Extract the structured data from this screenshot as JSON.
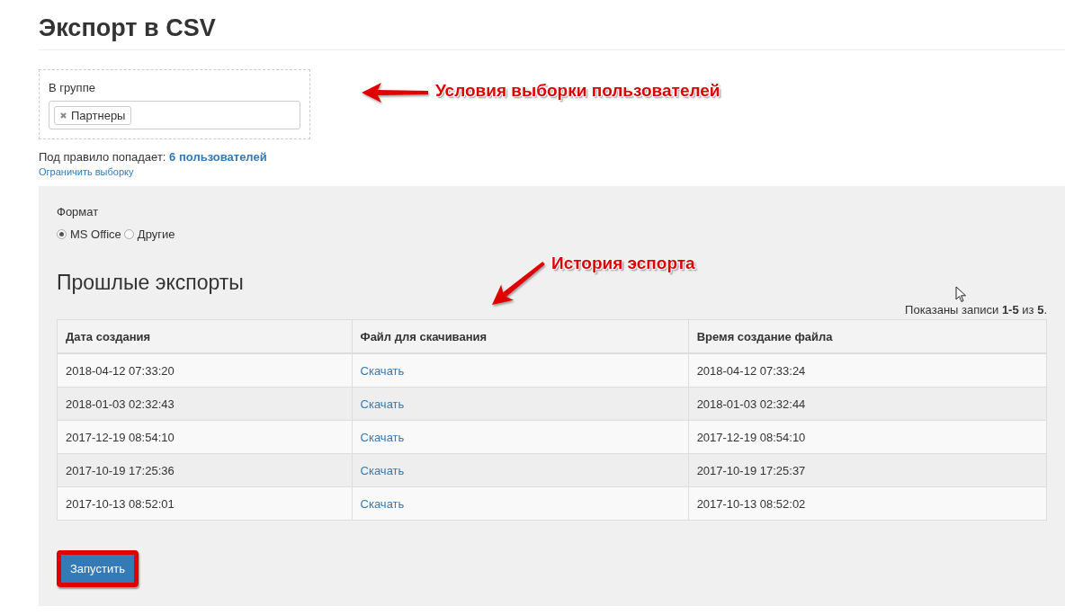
{
  "page_title": "Экспорт в CSV",
  "filter": {
    "label": "В группе",
    "tags": [
      {
        "label": "Партнеры"
      }
    ]
  },
  "match": {
    "text": "Под правило попадает:",
    "link": "6 пользователей",
    "limit_link": "Ограничить выборку"
  },
  "format": {
    "label": "Формат",
    "options": [
      {
        "label": "MS Office",
        "selected": true
      },
      {
        "label": "Другие",
        "selected": false
      }
    ]
  },
  "exports": {
    "title": "Прошлые экспорты",
    "summary": "Показаны записи **1-5** из **5**.",
    "columns": [
      "Дата создания",
      "Файл для скачивания",
      "Время создание файла"
    ],
    "rows": [
      {
        "created": "2018-04-12 07:33:20",
        "link": "Скачать",
        "finished": "2018-04-12 07:33:24"
      },
      {
        "created": "2018-01-03 02:32:43",
        "link": "Скачать",
        "finished": "2018-01-03 02:32:44"
      },
      {
        "created": "2017-12-19 08:54:10",
        "link": "Скачать",
        "finished": "2017-12-19 08:54:10"
      },
      {
        "created": "2017-10-19 17:25:36",
        "link": "Скачать",
        "finished": "2017-10-19 17:25:37"
      },
      {
        "created": "2017-10-13 08:52:01",
        "link": "Скачать",
        "finished": "2017-10-13 08:52:02"
      }
    ]
  },
  "run_button": "Запустить",
  "annotations": [
    {
      "text": "Условия выборки пользователей",
      "kind": "left"
    },
    {
      "text": "История эспорта",
      "kind": "down-left"
    }
  ]
}
